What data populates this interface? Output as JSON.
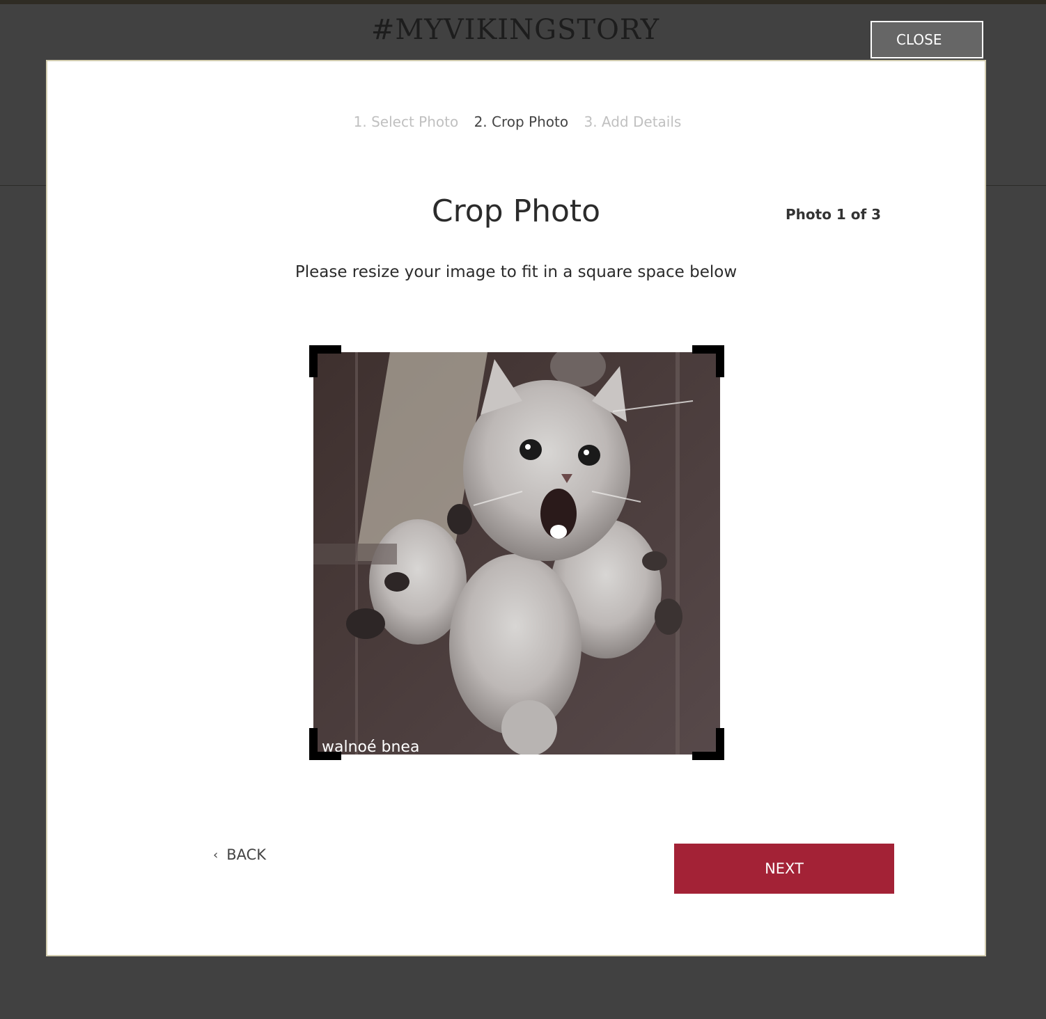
{
  "site": {
    "title": "#MYVIKINGSTORY"
  },
  "close": {
    "label": "CLOSE"
  },
  "steps": [
    {
      "label": "1. Select Photo",
      "state": "inactive"
    },
    {
      "label": "2. Crop Photo",
      "state": "active"
    },
    {
      "label": "3. Add Details",
      "state": "inactive"
    }
  ],
  "crop": {
    "heading": "Crop Photo",
    "counter": "Photo 1 of 3",
    "instructions": "Please resize your image to fit in a square space below",
    "photo_caption": "walnoé bnea"
  },
  "nav": {
    "back_label": "BACK",
    "next_label": "NEXT"
  },
  "colors": {
    "next_button": "#a32236",
    "backdrop": "#414141",
    "active_step": "#444444",
    "inactive_step": "#c0c0c0"
  },
  "icons": {
    "back": "chevron-left-icon"
  }
}
